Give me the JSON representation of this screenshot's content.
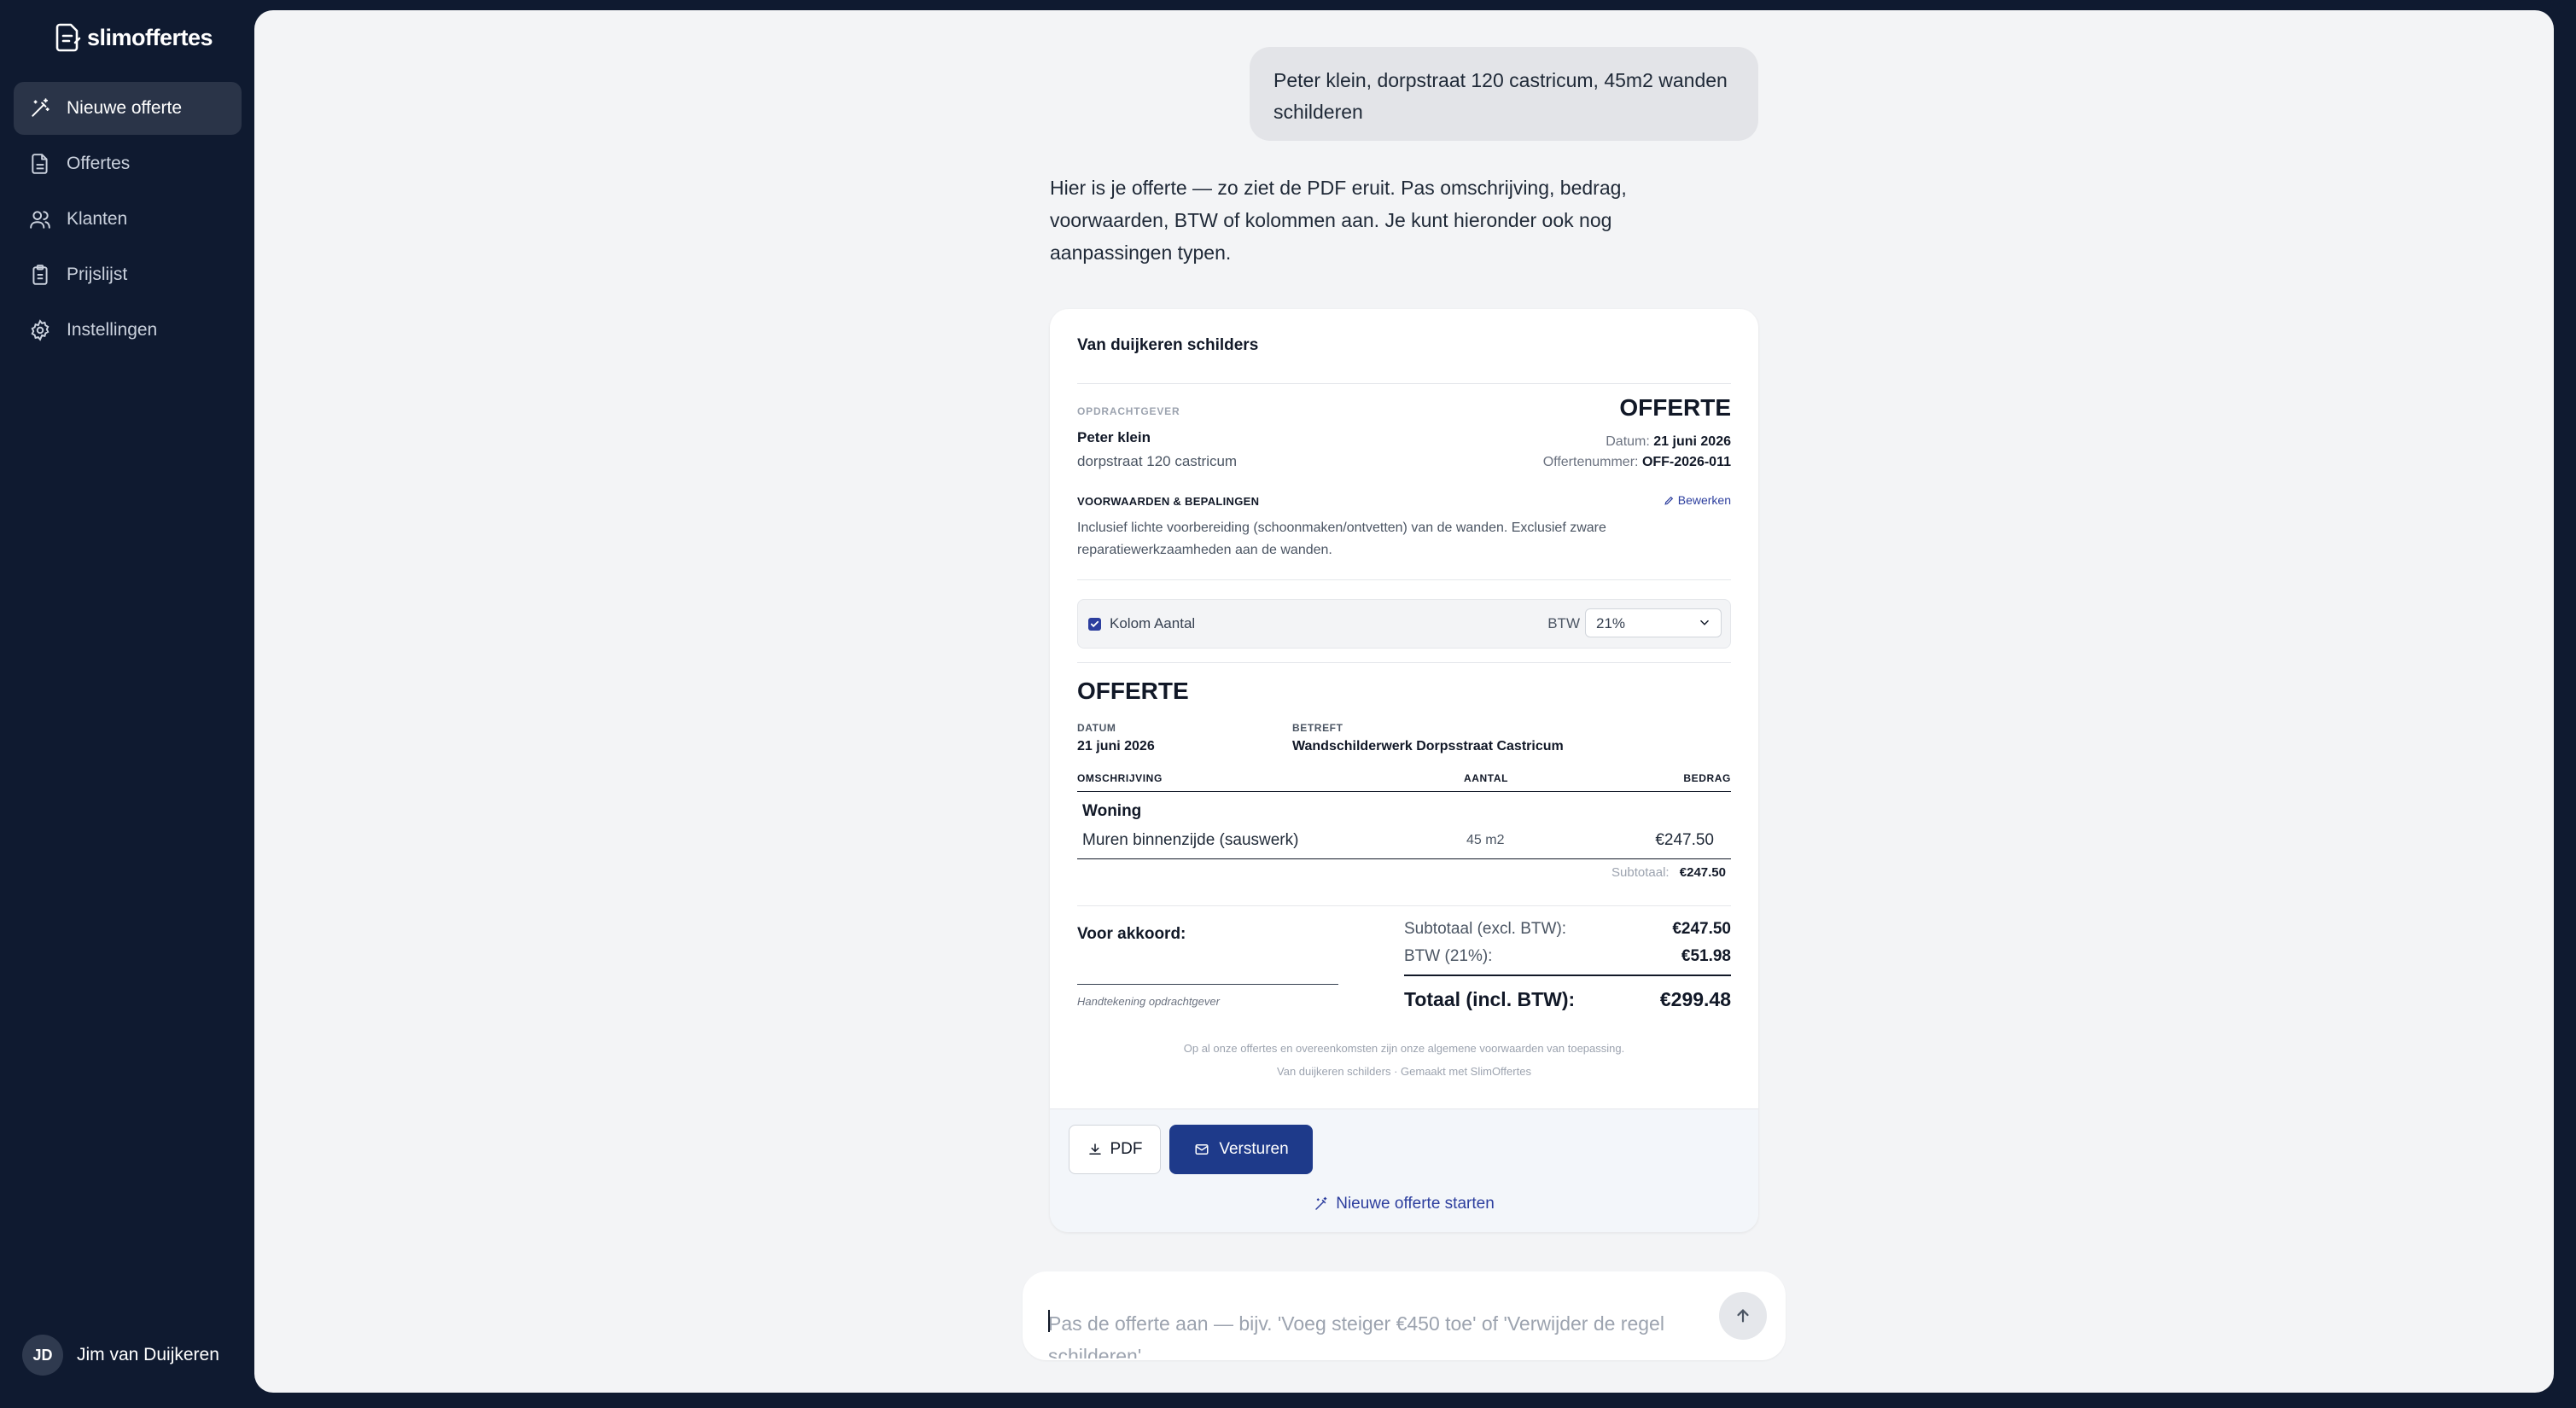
{
  "app": {
    "logo_text": "slimoffertes"
  },
  "sidebar": {
    "items": [
      {
        "label": "Nieuwe offerte",
        "icon": "magic-wand-icon",
        "active": true
      },
      {
        "label": "Offertes",
        "icon": "document-icon"
      },
      {
        "label": "Klanten",
        "icon": "users-icon"
      },
      {
        "label": "Prijslijst",
        "icon": "clipboard-icon"
      },
      {
        "label": "Instellingen",
        "icon": "gear-icon"
      }
    ],
    "user": {
      "initials": "JD",
      "name": "Jim van Duijkeren"
    }
  },
  "chat": {
    "user_message": "Peter klein, dorpstraat 120 castricum, 45m2 wanden schilderen",
    "assistant_message": "Hier is je offerte — zo ziet de PDF eruit. Pas omschrijving, bedrag, voorwaarden, BTW of kolommen aan. Je kunt hieronder ook nog aanpassingen typen.",
    "input_placeholder": "Pas de offerte aan — bijv. 'Voeg steiger €450 toe' of 'Verwijder de regel schilderen'"
  },
  "quote": {
    "company": "Van duijkeren schilders",
    "client_label": "OPDRACHTGEVER",
    "client_name": "Peter klein",
    "client_address": "dorpstraat 120 castricum",
    "title": "OFFERTE",
    "date_label": "Datum:",
    "date": "21 juni 2026",
    "number_label": "Offertenummer:",
    "number": "OFF-2026-011",
    "terms_label": "VOORWAARDEN & BEPALINGEN",
    "edit_label": "Bewerken",
    "terms_text": "Inclusief lichte voorbereiding (schoonmaken/ontvetten) van de wanden. Exclusief zware reparatiewerkzaamheden aan de wanden.",
    "column_toggle_label": "Kolom Aantal",
    "column_toggle_checked": true,
    "btw_label": "BTW",
    "btw_value": "21%",
    "doc": {
      "title": "OFFERTE",
      "date_label": "DATUM",
      "date": "21 juni 2026",
      "subject_label": "BETREFT",
      "subject": "Wandschilderwerk Dorpsstraat Castricum",
      "col_desc": "OMSCHRIJVING",
      "col_qty": "AANTAL",
      "col_amount": "BEDRAG",
      "group": "Woning",
      "line_desc": "Muren binnenzijde (sauswerk)",
      "line_qty": "45 m2",
      "line_amount": "€247.50",
      "subtotal_label": "Subtotaal:",
      "subtotal": "€247.50",
      "agree_label": "Voor akkoord:",
      "signature_caption": "Handtekening opdrachtgever",
      "sum_excl_label": "Subtotaal (excl. BTW):",
      "sum_excl": "€247.50",
      "vat_label": "BTW (21%):",
      "vat": "€51.98",
      "total_label": "Totaal (incl. BTW):",
      "total": "€299.48",
      "footer_1": "Op al onze offertes en overeenkomsten zijn onze algemene voorwaarden van toepassing.",
      "footer_2": "Van duijkeren schilders · Gemaakt met SlimOffertes"
    },
    "actions": {
      "pdf_label": "PDF",
      "send_label": "Versturen",
      "new_quote_label": "Nieuwe offerte starten"
    }
  },
  "colors": {
    "sidebar_bg": "#0f1a30",
    "accent": "#1e3a8a",
    "link": "#2c3e9e"
  }
}
